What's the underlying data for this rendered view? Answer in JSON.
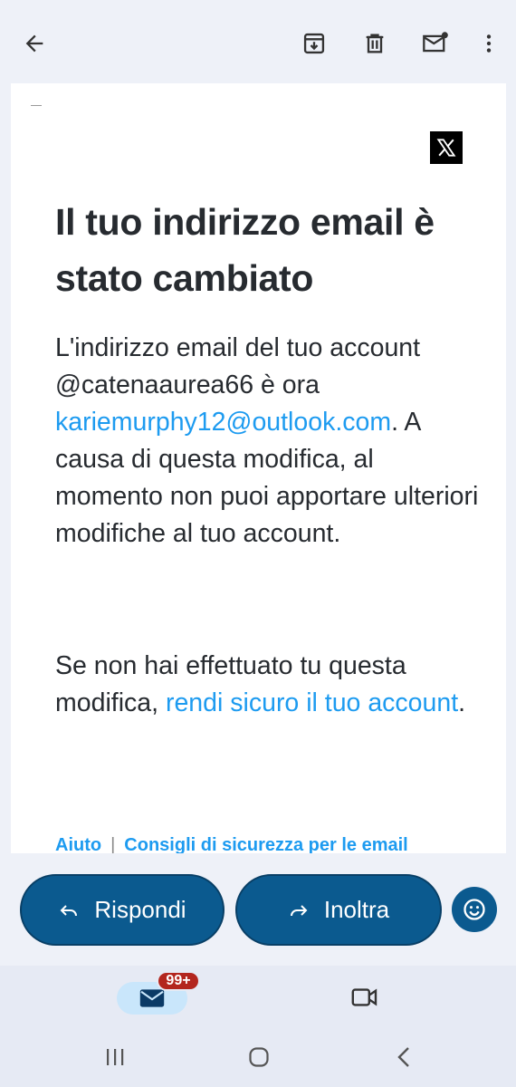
{
  "toolbar": {
    "back_icon": "arrow-back-icon",
    "archive_icon": "archive-icon",
    "delete_icon": "delete-icon",
    "mark_unread_icon": "mark-unread-icon",
    "more_icon": "more-vert-icon"
  },
  "email": {
    "logo": "X",
    "heading": "Il tuo indirizzo email è stato cambiato",
    "body1_prefix": "L'indirizzo email del tuo account @catenaaurea66 è ora ",
    "body1_email": "kariemurphy12@outlook.com",
    "body1_suffix": ". A causa di questa modifica, al momento non puoi apportare ulteriori modifiche al tuo account.",
    "body2_prefix": "Se non hai effettuato tu questa modifica, ",
    "body2_link": "rendi sicuro il tuo account",
    "body2_suffix": ".",
    "footer_help": "Aiuto",
    "footer_separator": "|",
    "footer_tips": "Consigli di sicurezza per le email"
  },
  "actions": {
    "reply_label": "Rispondi",
    "forward_label": "Inoltra",
    "emoji_icon": "emoji-icon"
  },
  "bottom_nav": {
    "mail_badge": "99+",
    "mail_icon": "mail-icon",
    "video_icon": "videocam-icon"
  },
  "colors": {
    "link": "#1d9bf0",
    "button": "#0b5a8f",
    "badge": "#b3261e"
  }
}
